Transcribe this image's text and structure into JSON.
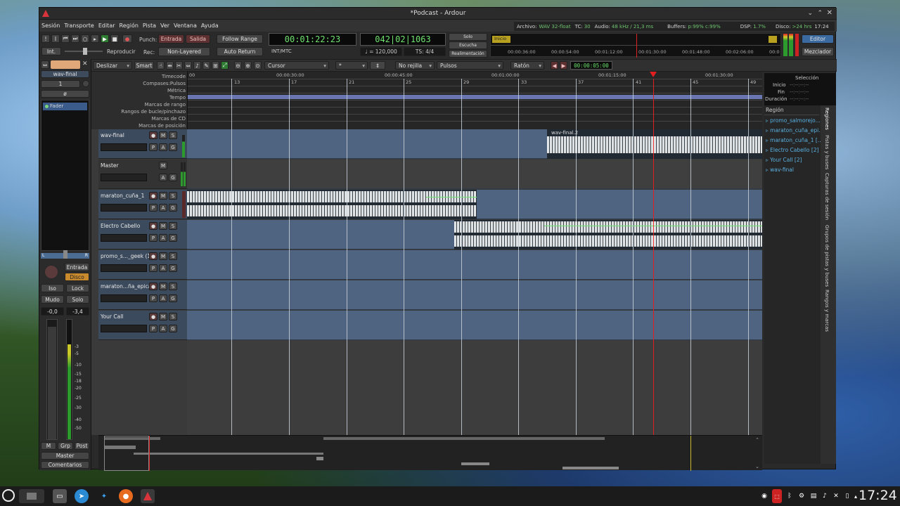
{
  "window": {
    "title": "*Podcast - Ardour"
  },
  "menu": [
    "Sesión",
    "Transporte",
    "Editar",
    "Región",
    "Pista",
    "Ver",
    "Ventana",
    "Ayuda"
  ],
  "status": {
    "archivo_label": "Archivo:",
    "archivo_value": "WAV 32-float",
    "tc_label": "TC:",
    "tc_value": "30",
    "audio_label": "Audio:",
    "audio_value": "48 kHz / 21,3 ms",
    "buffers_label": "Buffers:",
    "buffers_value": "p:99% c:99%",
    "dsp_label": "DSP:",
    "dsp_value": "1.7%",
    "disco_label": "Disco:",
    "disco_value": ">24 hrs",
    "time": "17:24"
  },
  "toolbar": {
    "int": "Int.",
    "reproducir": "Reproducir",
    "punch_label": "Punch:",
    "entrada": "Entrada",
    "salida": "Salida",
    "rec_label": "Rec:",
    "non_layered": "Non-Layered",
    "follow_range": "Follow Range",
    "auto_return": "Auto Return",
    "clock1": "00:01:22:23",
    "int_mtc": "INT/MTC",
    "clock2": "042|02|1063",
    "tempo": "♩ = 120,000",
    "ts": "TS: 4/4",
    "solo": "Solo",
    "escucha": "Escucha",
    "realimentacion": "Realimentación",
    "inicio": "Inicio",
    "editor": "Editor",
    "mezclador": "Mezclador"
  },
  "minitimeline": [
    "00:00:36:00",
    "00:00:54:00",
    "00:01:12:00",
    "00:01:30:00",
    "00:01:48:00",
    "00:02:06:00",
    "00:0"
  ],
  "edit_toolbar": {
    "deslizar": "Deslizar",
    "smart": "Smart",
    "cursor": "Cursor",
    "snap_val": "*",
    "no_rejilla": "No rejilla",
    "pulsos": "Pulsos",
    "raton": "Ratón",
    "nudge": "00:00:05:00"
  },
  "rulers": [
    "Timecode",
    "Compases:Pulsos",
    "Métrica",
    "Tempo",
    "Marcas de rango",
    "Rangos de bucle/pinchazo",
    "Marcas de CD",
    "Marcas de posición"
  ],
  "timecode_ticks": [
    "00",
    "00:00:30:00",
    "00:00:45:00",
    "00:01:00:00",
    "00:01:15:00",
    "00:01:30:00"
  ],
  "bar_ticks": [
    "13",
    "17",
    "21",
    "25",
    "29",
    "33",
    "37",
    "41",
    "45",
    "49"
  ],
  "strip": {
    "name": "wav-final",
    "num": "1",
    "phase": "ø",
    "fader_tab": "Fader",
    "entrada": "Entrada",
    "disco": "Disco",
    "iso": "Iso",
    "lock": "Lock",
    "mudo": "Mudo",
    "solo": "Solo",
    "gain": "-0,0",
    "peak": "-3,4",
    "m": "M",
    "grp": "Grp",
    "post": "Post",
    "master": "Master",
    "comentarios": "Comentarios",
    "scale": [
      "-3",
      "-5",
      "-10",
      "-15",
      "-18",
      "-20",
      "-25",
      "-30",
      "-40",
      "-50"
    ]
  },
  "tracks": [
    {
      "name": "wav-final",
      "buttons": [
        "M",
        "S",
        "P",
        "A",
        "G"
      ]
    },
    {
      "name": "Master",
      "buttons": [
        "M",
        "A",
        "G"
      ]
    },
    {
      "name": "maraton_cuña_1",
      "buttons": [
        "M",
        "S",
        "P",
        "A",
        "G"
      ]
    },
    {
      "name": "Electro Cabello",
      "buttons": [
        "M",
        "S",
        "P",
        "A",
        "G"
      ]
    },
    {
      "name": "promo_s..._geek (1)",
      "buttons": [
        "M",
        "S",
        "P",
        "A",
        "G"
      ]
    },
    {
      "name": "maraton...ña_epica",
      "buttons": [
        "M",
        "S",
        "P",
        "A",
        "G"
      ]
    },
    {
      "name": "Your Call",
      "buttons": [
        "M",
        "S",
        "P",
        "A",
        "G"
      ]
    }
  ],
  "regions_on_canvas": {
    "wav_final": "wav-final.2"
  },
  "selection": {
    "title": "Selección",
    "inicio": "Inicio",
    "fin": "Fin",
    "duracion": "Duración",
    "dash": "--:--:--:--"
  },
  "region_list": {
    "header": "Región",
    "items": [
      "promo_salmorejo...",
      "maraton_cuña_epi...",
      "maraton_cuña_1 [...",
      "Electro Cabello [2]",
      "Your Call [2]",
      "wav-final"
    ]
  },
  "side_tabs": [
    "Regiones",
    "Pistas y buses",
    "Capturas de sesión",
    "Grupos de pistas y buses",
    "Rangos y marcas"
  ],
  "taskbar": {
    "clock": "17:24"
  }
}
